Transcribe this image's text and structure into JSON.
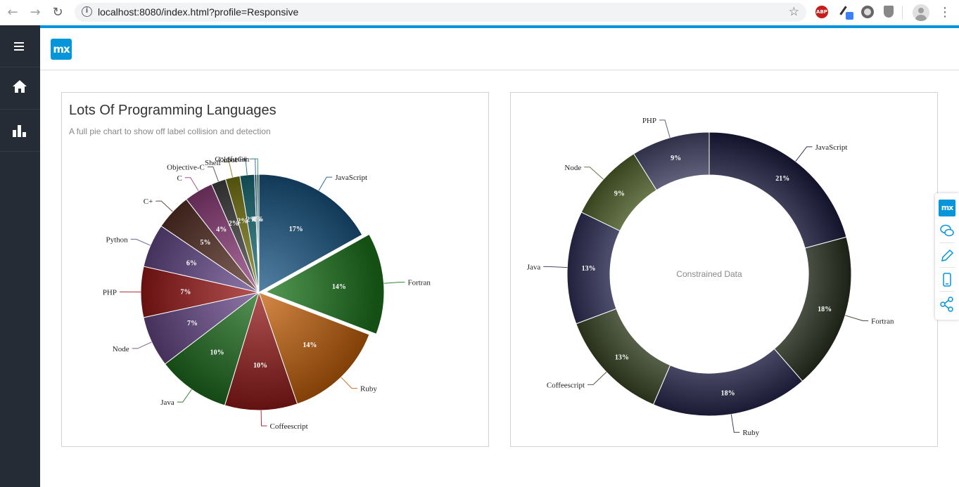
{
  "browser": {
    "url": "localhost:8080/index.html?profile=Responsive",
    "extensions": [
      "adblock-plus-icon",
      "color-picker-icon",
      "ring-icon",
      "shield-icon"
    ],
    "abp_label": "ABP"
  },
  "app": {
    "logo_text": "mx",
    "accent_color": "#0595db",
    "sidebar_items": [
      {
        "icon": "hamburger-menu-icon"
      },
      {
        "icon": "home-icon"
      },
      {
        "icon": "bar-chart-icon"
      }
    ]
  },
  "toolbar": {
    "logo_text": "mx",
    "icons": [
      "feedback-chat-icon",
      "edit-pencil-icon",
      "mobile-device-icon",
      "share-icon"
    ]
  },
  "chart_data": [
    {
      "type": "pie",
      "title": "Lots Of Programming Languages",
      "subtitle": "A full pie chart to show off label collision and detection",
      "slices": [
        {
          "label": "JavaScript",
          "value": 17,
          "pct_label": "17%",
          "color": "#1a5786"
        },
        {
          "label": "Fortran",
          "value": 14,
          "pct_label": "14%",
          "color": "#1f7a1f",
          "exploded": true
        },
        {
          "label": "Ruby",
          "value": 14,
          "pct_label": "14%",
          "color": "#c7620a"
        },
        {
          "label": "Coffeescript",
          "value": 10,
          "pct_label": "10%",
          "color": "#961a1a"
        },
        {
          "label": "Java",
          "value": 10,
          "pct_label": "10%",
          "color": "#1e6e1e"
        },
        {
          "label": "Node",
          "value": 7,
          "pct_label": "7%",
          "color": "#6a4a8c"
        },
        {
          "label": "PHP",
          "value": 7,
          "pct_label": "7%",
          "color": "#9e1a1a"
        },
        {
          "label": "Python",
          "value": 6,
          "pct_label": "6%",
          "color": "#684b8e"
        },
        {
          "label": "C+",
          "value": 5,
          "pct_label": "5%",
          "color": "#5a3328"
        },
        {
          "label": "C",
          "value": 4,
          "pct_label": "4%",
          "color": "#934080"
        },
        {
          "label": "Objective-C",
          "value": 2,
          "pct_label": "2%",
          "color": "#454545"
        },
        {
          "label": "Shell",
          "value": 2,
          "pct_label": "2%",
          "color": "#7d7d15"
        },
        {
          "label": "Cobol",
          "value": 2,
          "pct_label": "2%",
          "color": "#1a6f7a"
        },
        {
          "label": "C#",
          "value": 0.3,
          "pct_label": "0%",
          "color": "#2a5fa0"
        },
        {
          "label": "Coldfusion",
          "value": 0.3,
          "pct_label": "0%",
          "color": "#2a8a5a"
        }
      ]
    },
    {
      "type": "pie",
      "variant": "donut",
      "center_label": "Constrained Data",
      "slices": [
        {
          "label": "JavaScript",
          "value": 21,
          "pct_label": "21%",
          "color": "#1c1c42"
        },
        {
          "label": "Fortran",
          "value": 18,
          "pct_label": "18%",
          "color": "#2b3320"
        },
        {
          "label": "Ruby",
          "value": 18,
          "pct_label": "18%",
          "color": "#282850"
        },
        {
          "label": "Coffeescript",
          "value": 13,
          "pct_label": "13%",
          "color": "#3e4a28"
        },
        {
          "label": "Java",
          "value": 13,
          "pct_label": "13%",
          "color": "#32325e"
        },
        {
          "label": "Node",
          "value": 9,
          "pct_label": "9%",
          "color": "#56692e"
        },
        {
          "label": "PHP",
          "value": 9,
          "pct_label": "9%",
          "color": "#4a4a70"
        }
      ]
    }
  ]
}
